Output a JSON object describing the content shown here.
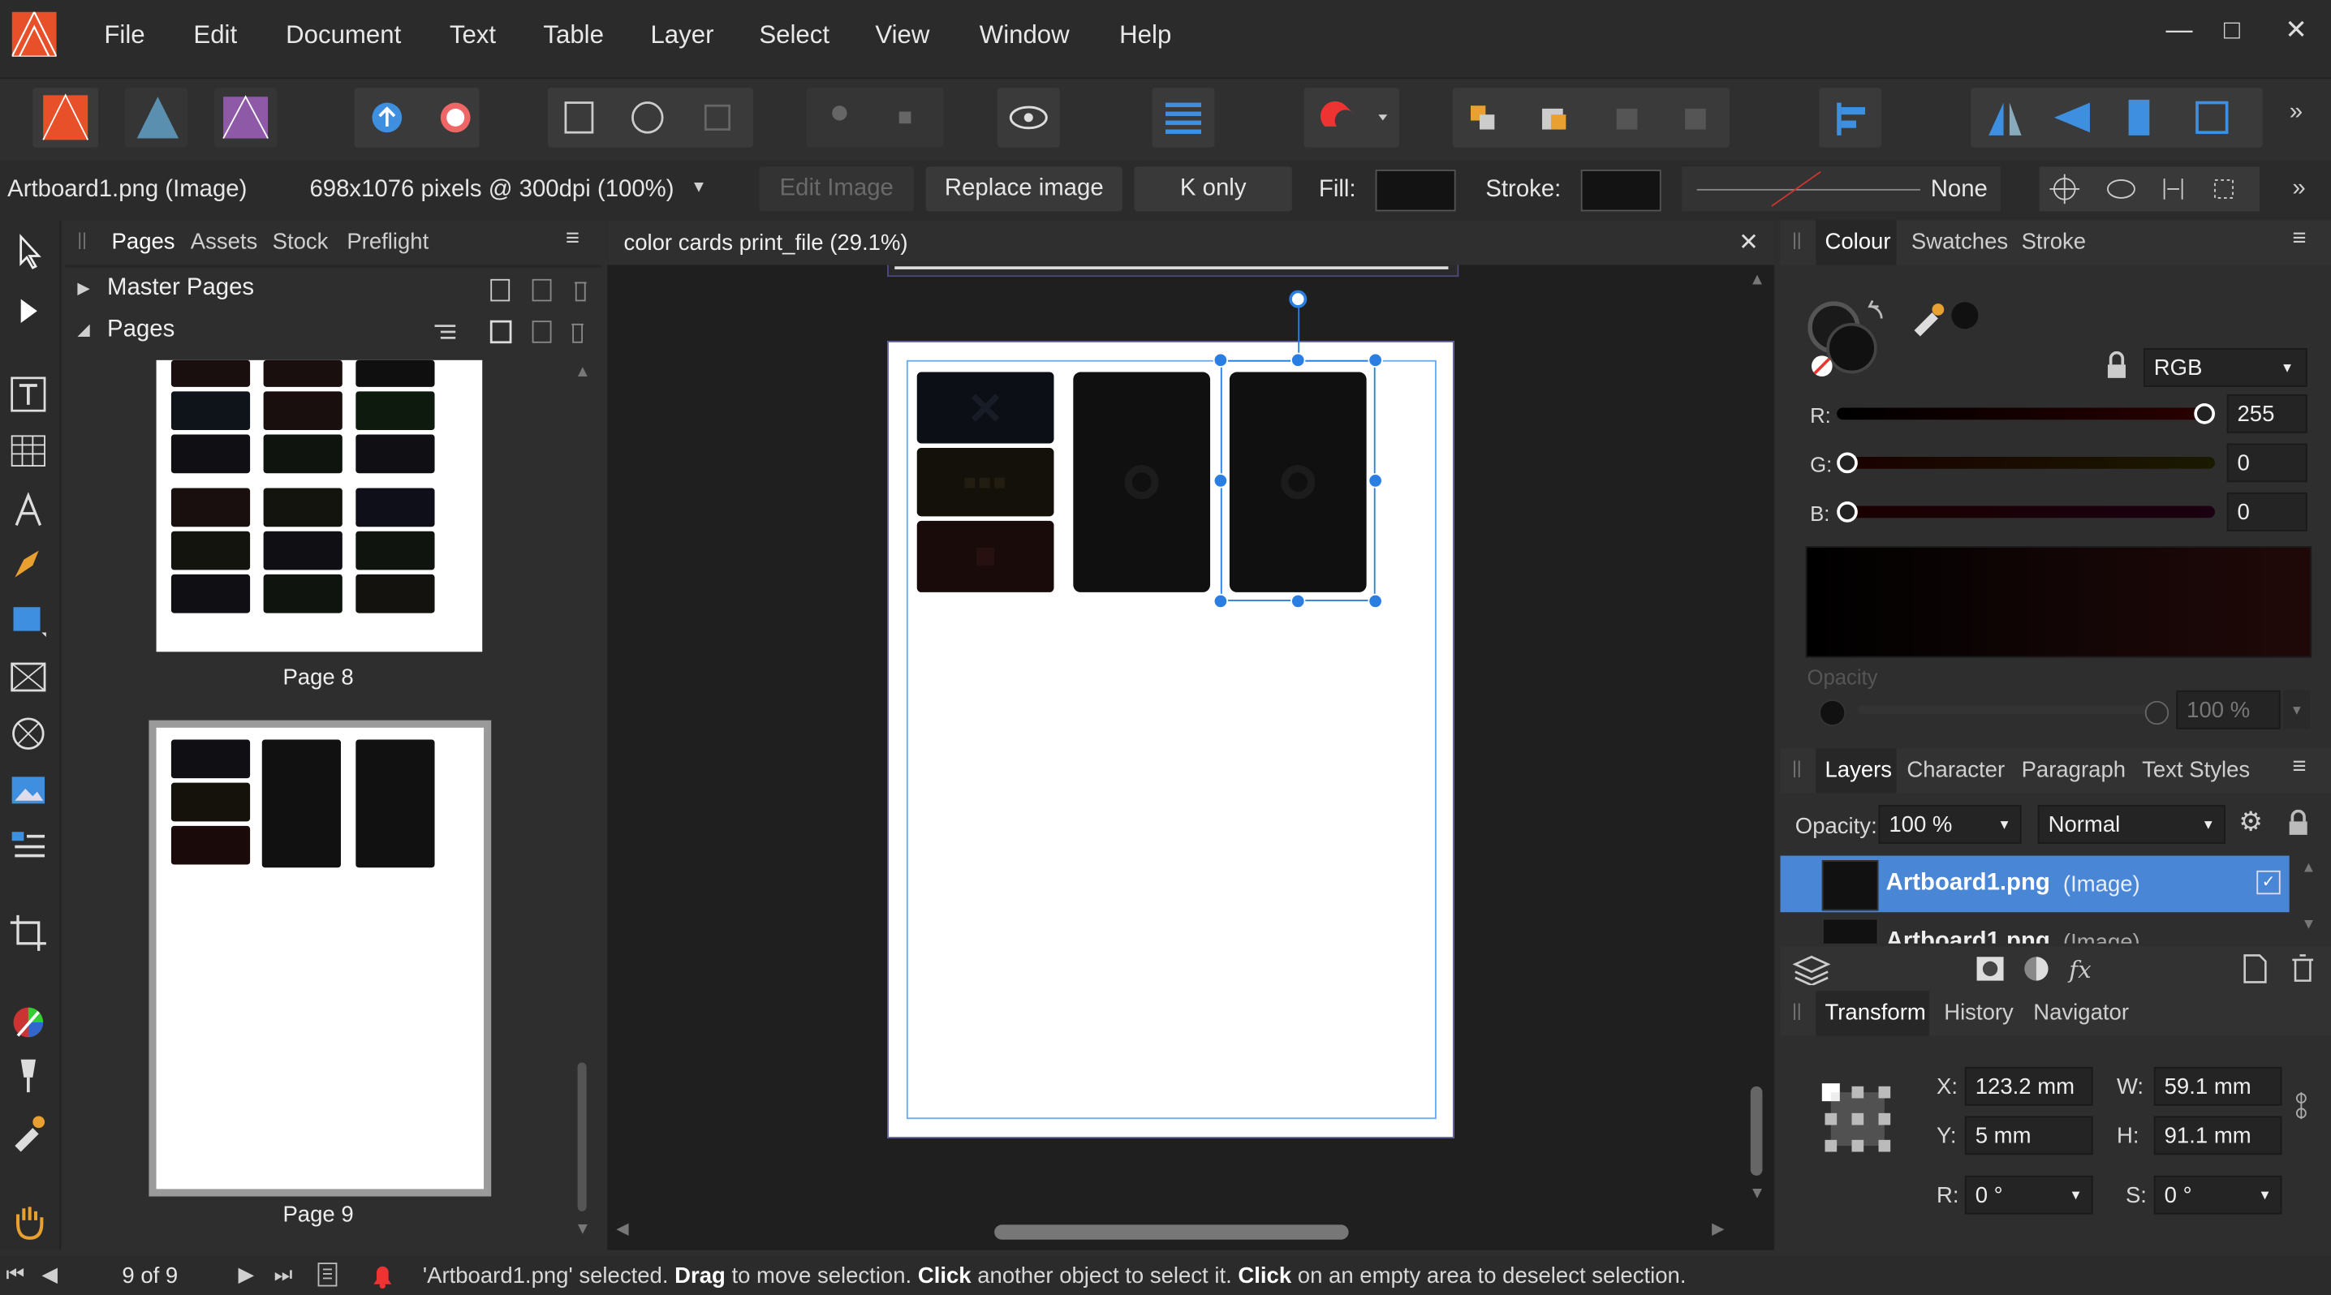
{
  "menu": {
    "items": [
      "File",
      "Edit",
      "Document",
      "Text",
      "Table",
      "Layer",
      "Select",
      "View",
      "Window",
      "Help"
    ]
  },
  "context": {
    "object_label": "Artboard1.png (Image)",
    "dimensions": "698x1076 pixels @ 300dpi (100%)",
    "edit_image": "Edit Image",
    "replace_image": "Replace image",
    "k_only": "K only",
    "fill_label": "Fill:",
    "stroke_label": "Stroke:",
    "stroke_value": "None"
  },
  "pages_panel": {
    "tabs": [
      "Pages",
      "Assets",
      "Stock",
      "Preflight"
    ],
    "master_pages": "Master Pages",
    "pages": "Pages",
    "page8_label": "Page 8",
    "page9_label": "Page 9"
  },
  "document": {
    "tab_title": "color cards print_file (29.1%)"
  },
  "colour_panel": {
    "tabs": [
      "Colour",
      "Swatches",
      "Stroke"
    ],
    "model": "RGB",
    "r_label": "R:",
    "r_value": "255",
    "r_level": 1.0,
    "g_label": "G:",
    "g_value": "0",
    "g_level": 0.0,
    "b_label": "B:",
    "b_value": "0",
    "b_level": 0.0,
    "opacity_label": "Opacity",
    "opacity_value": "100 %"
  },
  "layers_panel": {
    "tabs": [
      "Layers",
      "Character",
      "Paragraph",
      "Text Styles"
    ],
    "opacity_label": "Opacity:",
    "opacity_value": "100 %",
    "blend_mode": "Normal",
    "layer1_name": "Artboard1.png",
    "layer1_type": "(Image)",
    "layer2_name": "Artboard1.png",
    "layer2_type": "(Image)"
  },
  "transform_panel": {
    "tabs": [
      "Transform",
      "History",
      "Navigator"
    ],
    "x_label": "X:",
    "x_value": "123.2 mm",
    "y_label": "Y:",
    "y_value": "5 mm",
    "w_label": "W:",
    "w_value": "59.1 mm",
    "h_label": "H:",
    "h_value": "91.1 mm",
    "r_label": "R:",
    "r_value": "0 °",
    "s_label": "S:",
    "s_value": "0 °"
  },
  "status": {
    "page_counter": "9 of 9",
    "msg_1": "'Artboard1.png' selected. ",
    "msg_drag": "Drag",
    "msg_2": " to move selection. ",
    "msg_click": "Click",
    "msg_3": " another object to select it. ",
    "msg_click2": "Click",
    "msg_4": " on an empty area to deselect selection."
  },
  "colors": {
    "accent": "#2a7de1",
    "selection_row": "#4a86d6"
  }
}
